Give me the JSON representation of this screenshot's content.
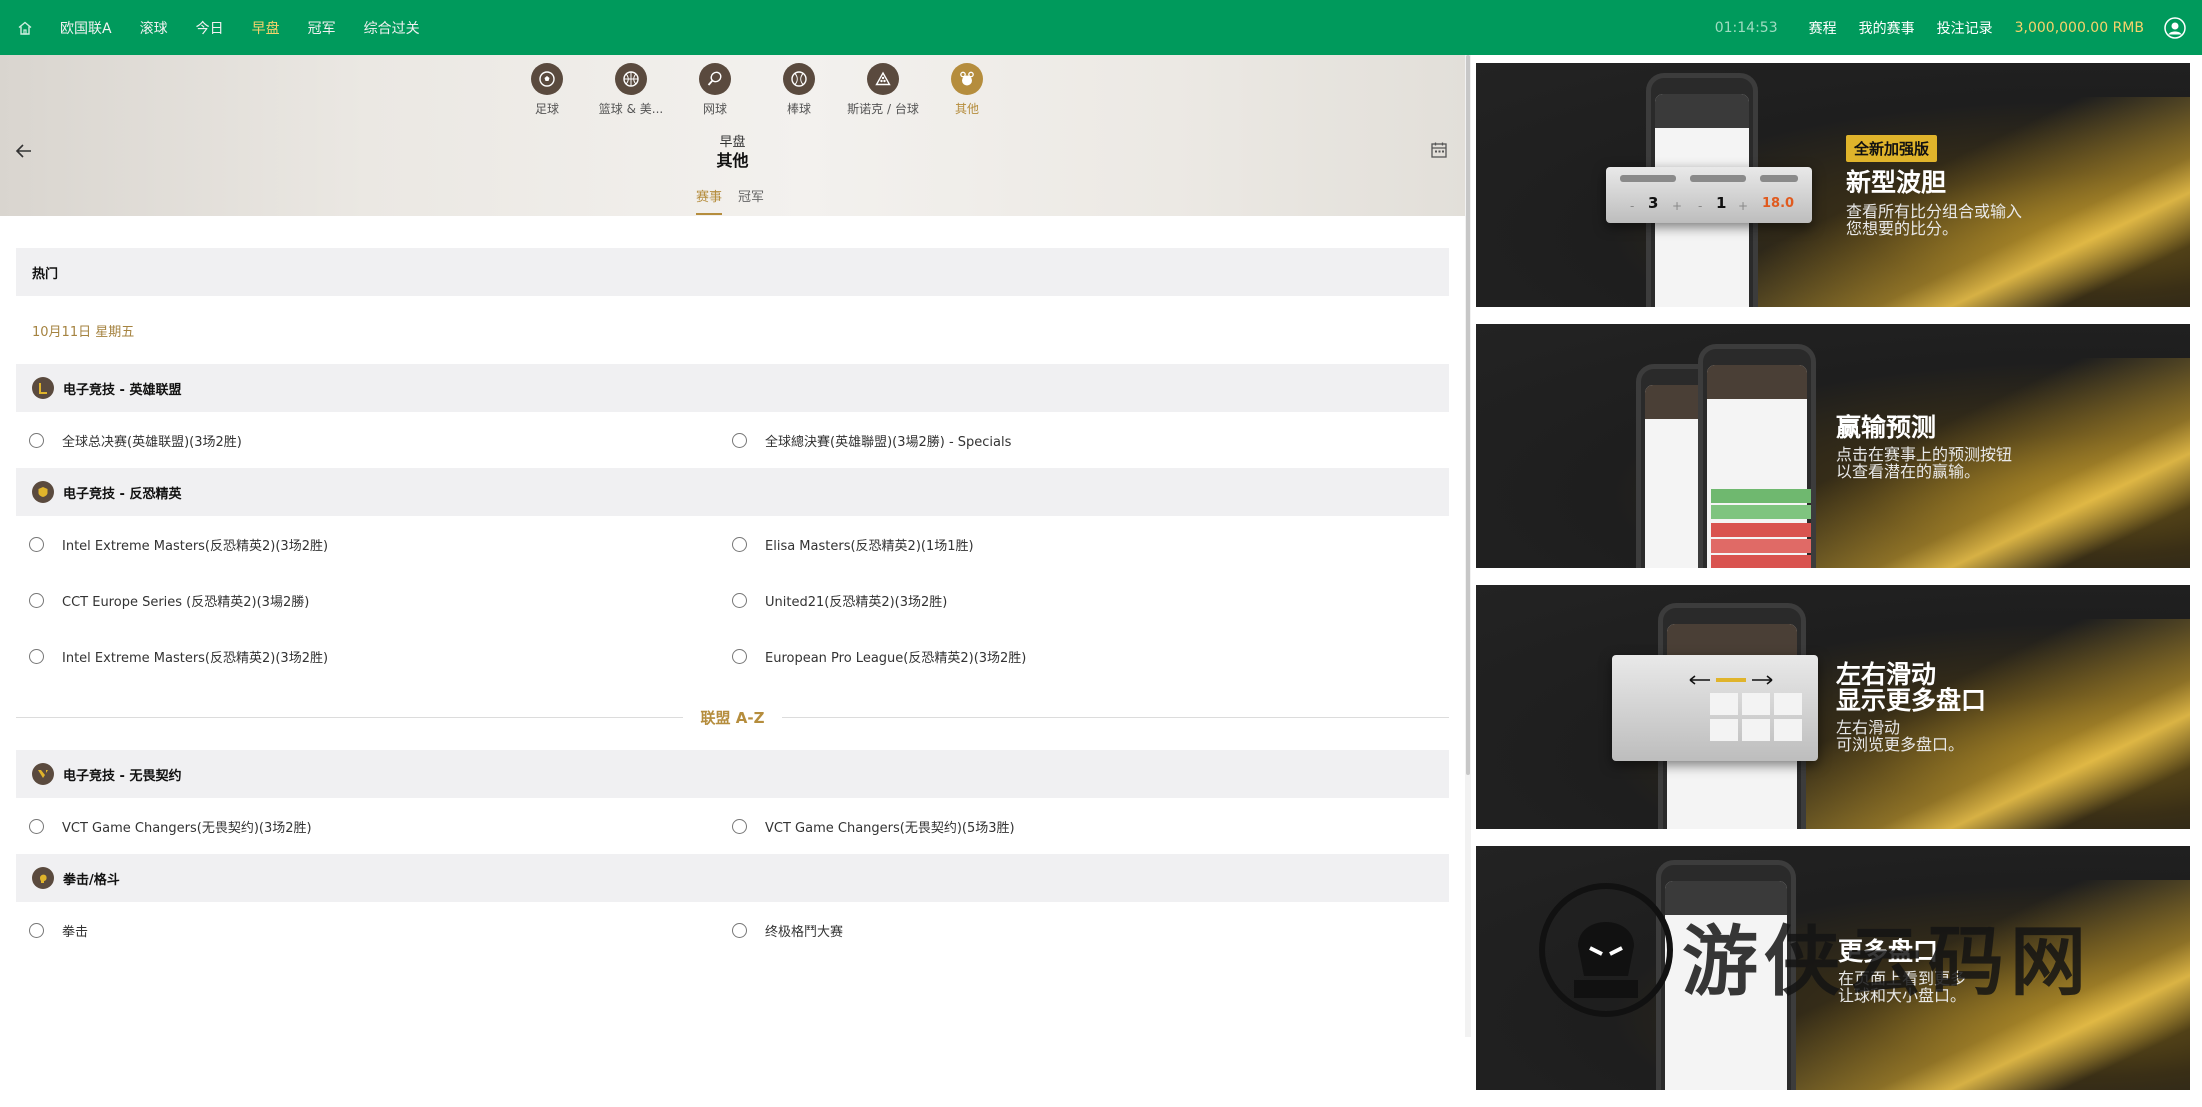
{
  "topnav": {
    "items": [
      {
        "label": "欧国联A",
        "active": false
      },
      {
        "label": "滚球",
        "active": false
      },
      {
        "label": "今日",
        "active": false
      },
      {
        "label": "早盘",
        "active": true
      },
      {
        "label": "冠军",
        "active": false
      },
      {
        "label": "综合过关",
        "active": false
      }
    ],
    "clock": "01:14:53",
    "links": [
      "赛程",
      "我的赛事",
      "投注记录"
    ],
    "balance": "3,000,000.00 RMB"
  },
  "sports": [
    {
      "label": "足球",
      "icon": "soccer-ball-icon",
      "active": false
    },
    {
      "label": "篮球 & 美...",
      "icon": "basketball-icon",
      "active": false
    },
    {
      "label": "网球",
      "icon": "tennis-icon",
      "active": false
    },
    {
      "label": "棒球",
      "icon": "baseball-icon",
      "active": false
    },
    {
      "label": "斯诺克 / 台球",
      "icon": "snooker-icon",
      "active": false
    },
    {
      "label": "其他",
      "icon": "other-sports-icon",
      "active": true
    }
  ],
  "hero": {
    "subtitle": "早盘",
    "title": "其他"
  },
  "tabs": [
    {
      "label": "赛事",
      "active": true
    },
    {
      "label": "冠军",
      "active": false
    }
  ],
  "hot": {
    "heading": "热门",
    "date": "10月11日 星期五",
    "groups": [
      {
        "name": "电子竞技 - 英雄联盟",
        "rows": [
          [
            "全球总决赛(英雄联盟)(3场2胜)",
            "全球總決賽(英雄聯盟)(3場2勝) - Specials"
          ]
        ]
      },
      {
        "name": "电子竞技 - 反恐精英",
        "rows": [
          [
            "Intel Extreme Masters(反恐精英2)(3场2胜)",
            "Elisa Masters(反恐精英2)(1场1胜)"
          ],
          [
            "CCT Europe Series (反恐精英2)(3場2勝)",
            "United21(反恐精英2)(3场2胜)"
          ],
          [
            "Intel Extreme Masters(反恐精英2)(3场2胜)",
            "European Pro League(反恐精英2)(3场2胜)"
          ]
        ]
      }
    ]
  },
  "az_label": "联盟 A-Z",
  "az_groups": [
    {
      "name": "电子竞技 - 无畏契约",
      "rows": [
        [
          "VCT Game Changers(无畏契约)(3场2胜)",
          "VCT Game Changers(无畏契约)(5场3胜)"
        ]
      ]
    },
    {
      "name": "拳击/格斗",
      "rows": [
        [
          "拳击",
          "终极格鬥大赛"
        ]
      ]
    }
  ],
  "promos": [
    {
      "badge": "全新加强版",
      "title": "新型波胆",
      "desc": [
        "查看所有比分组合或输入",
        "您想要的比分。"
      ],
      "score_a": "3",
      "score_b": "1",
      "odds": "18.0"
    },
    {
      "title": "赢输预测",
      "desc": [
        "点击在赛事上的预测按钮",
        "以查看潜在的赢输。"
      ]
    },
    {
      "title_lines": [
        "左右滑动",
        "显示更多盘口"
      ],
      "desc": [
        "左右滑动",
        "可浏览更多盘口。"
      ]
    },
    {
      "title": "更多盘口",
      "desc": [
        "在页面上看到更多",
        "让球和大小盘口。"
      ]
    }
  ],
  "watermark": "游侠云码网",
  "colors": {
    "brand_green": "#009a5c",
    "gold": "#b58d3d",
    "active_nav": "#f6d36b"
  }
}
